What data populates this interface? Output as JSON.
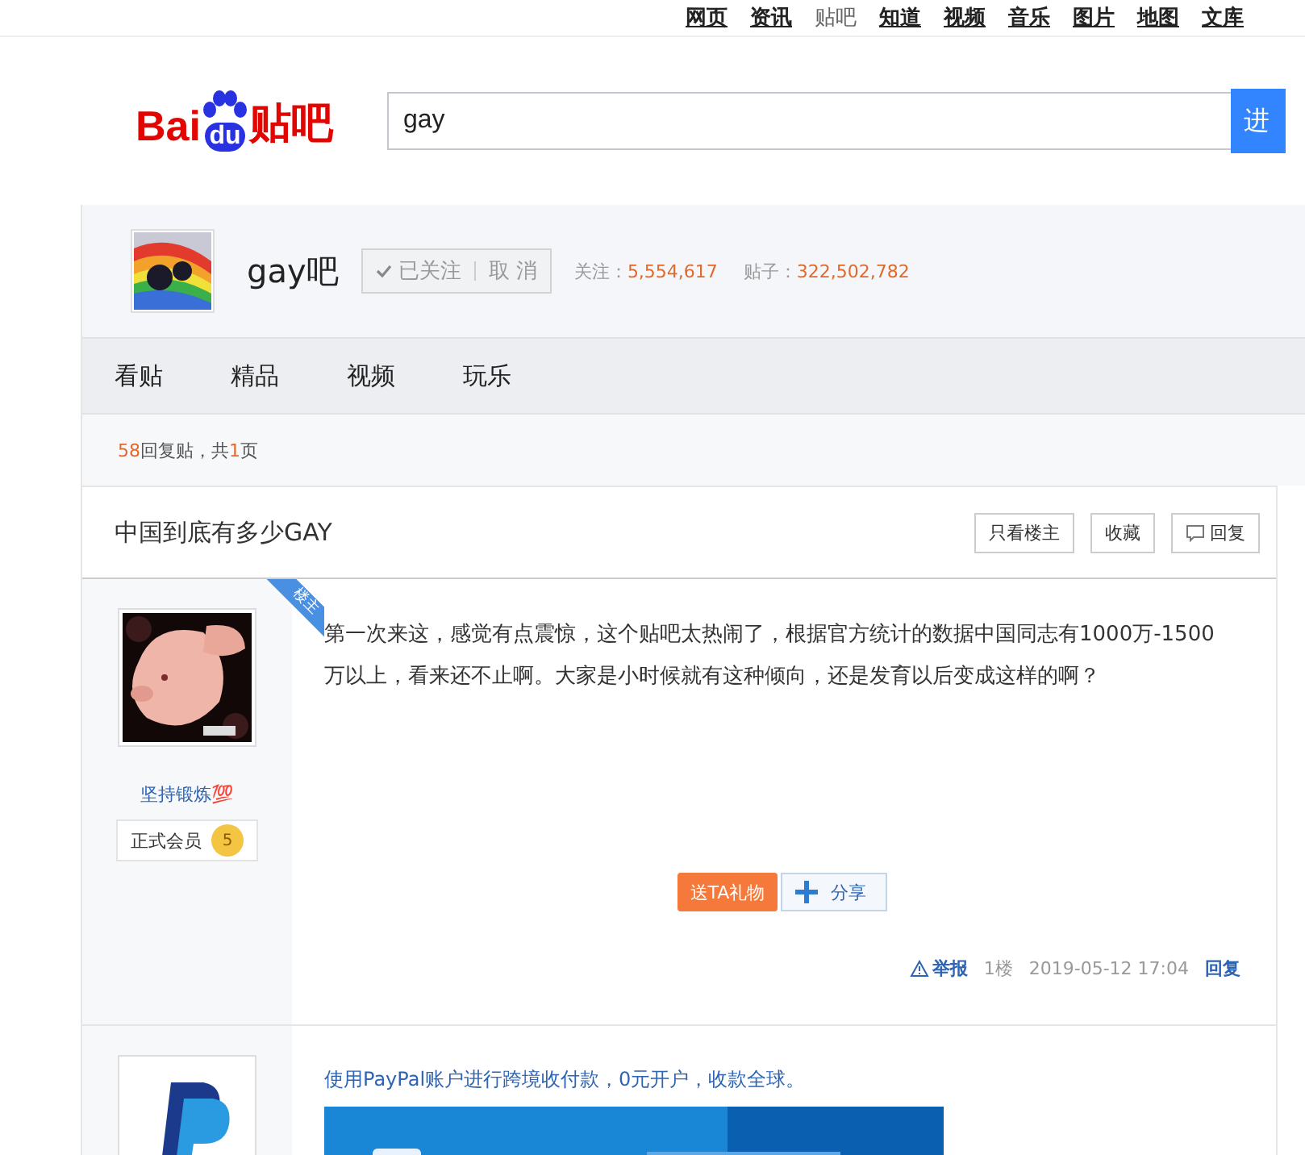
{
  "top_nav": [
    {
      "label": "网页",
      "selected": false
    },
    {
      "label": "资讯",
      "selected": false
    },
    {
      "label": "贴吧",
      "selected": true
    },
    {
      "label": "知道",
      "selected": false
    },
    {
      "label": "视频",
      "selected": false
    },
    {
      "label": "音乐",
      "selected": false
    },
    {
      "label": "图片",
      "selected": false
    },
    {
      "label": "地图",
      "selected": false
    },
    {
      "label": "文库",
      "selected": false
    }
  ],
  "logo": {
    "part_1": "Bai",
    "part_2": "du",
    "part_3": "贴吧"
  },
  "search": {
    "value": "gay",
    "button": "进"
  },
  "forum": {
    "name": "gay吧",
    "follow_button": {
      "followed": "已关注",
      "cancel": "取 消"
    },
    "followers_label": "关注：",
    "followers": "5,554,617",
    "posts_label": "贴子：",
    "posts": "322,502,782"
  },
  "tabs": [
    {
      "label": "看贴",
      "selected": false
    },
    {
      "label": "精品",
      "selected": false
    },
    {
      "label": "视频",
      "selected": false
    },
    {
      "label": "玩乐",
      "selected": false
    }
  ],
  "reply_count": {
    "count": "58",
    "text_1": "回复贴，共",
    "pages": "1",
    "text_2": "页"
  },
  "thread": {
    "title": "中国到底有多少GAY",
    "buttons": [
      "只看楼主",
      "收藏",
      "回复"
    ]
  },
  "posts": [
    {
      "kind": "post",
      "author": "坚持锻炼💯",
      "badge": "楼主",
      "rank": "正式会员",
      "level": "5",
      "content": "第一次来这，感觉有点震惊，这个贴吧太热闹了，根据官方统计的数据中国同志有1000万-1500万以上，看来还不止啊。大家是小时候就有这种倾向，还是发育以后变成这样的啊？",
      "gift_button": "送TA礼物",
      "share_button": "分享",
      "report": "举报",
      "floor": "1楼",
      "time": "2019-05-12 17:04",
      "reply": "回复"
    },
    {
      "kind": "ad",
      "content": "使用PayPal账户进行跨境收付款，0元开户，收款全球。"
    }
  ]
}
